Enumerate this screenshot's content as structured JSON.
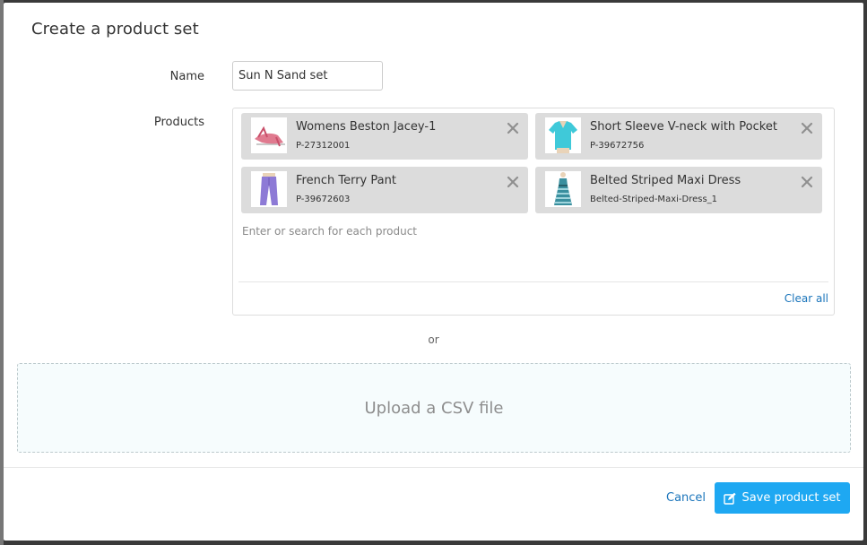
{
  "dialog": {
    "title": "Create a product set"
  },
  "name_field": {
    "label": "Name",
    "value": "Sun N Sand set"
  },
  "products_field": {
    "label": "Products",
    "items": [
      {
        "name": "Womens Beston Jacey-1",
        "sku": "P-27312001",
        "thumb": "sandal-thumbnail"
      },
      {
        "name": "Short Sleeve V-neck with Pocket",
        "sku": "P-39672756",
        "thumb": "tshirt-thumbnail"
      },
      {
        "name": "French Terry Pant",
        "sku": "P-39672603",
        "thumb": "pants-thumbnail"
      },
      {
        "name": "Belted Striped Maxi Dress",
        "sku": "Belted-Striped-Maxi-Dress_1",
        "thumb": "dress-thumbnail"
      }
    ],
    "search_placeholder": "Enter or search for each product",
    "clear_all_label": "Clear all"
  },
  "separator_text": "or",
  "upload": {
    "label": "Upload a CSV file"
  },
  "footer": {
    "cancel_label": "Cancel",
    "save_label": "Save product set",
    "save_icon": "edit-icon"
  },
  "colors": {
    "primary": "#1ea8f2",
    "link": "#1b75bb",
    "chip_bg": "#dcdcdc"
  }
}
